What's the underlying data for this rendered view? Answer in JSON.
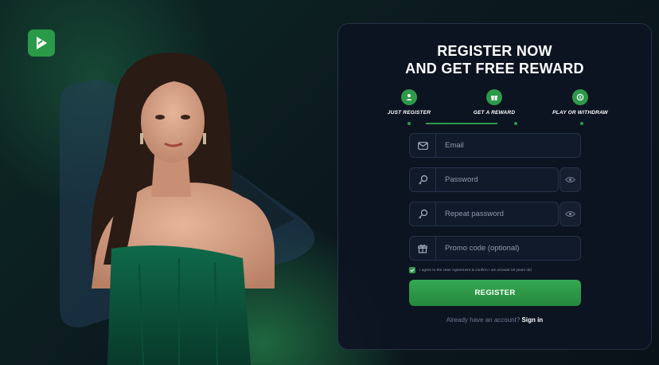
{
  "colors": {
    "accent": "#2d9a4a",
    "panel_bg": "#0d1422",
    "field_bg": "#111a2a",
    "border": "#26314a"
  },
  "brand": {
    "logo_icon": "play-logo-icon"
  },
  "hero": {
    "image": "woman in green strapless dress"
  },
  "register": {
    "title_line1": "REGISTER NOW",
    "title_line2": "AND GET FREE REWARD",
    "steps": [
      {
        "label": "JUST REGISTER",
        "icon": "user-icon"
      },
      {
        "label": "GET A REWARD",
        "icon": "gift-icon"
      },
      {
        "label": "PLAY OR WITHDRAW",
        "icon": "coin-icon"
      }
    ],
    "fields": {
      "email": {
        "placeholder": "Email",
        "value": "",
        "icon": "mail-icon"
      },
      "password": {
        "placeholder": "Password",
        "value": "",
        "icon": "key-icon"
      },
      "repeat_password": {
        "placeholder": "Repeat password",
        "value": "",
        "icon": "key-icon"
      },
      "promo": {
        "placeholder": "Promo code (optional)",
        "value": "",
        "icon": "gift-icon"
      }
    },
    "agree_text": "I agree to the User Agreement & confirm I am at least 18 years old",
    "agree_checked": true,
    "register_button": "REGISTER",
    "have_account": "Already have an account?",
    "signin_link": "Sign in"
  }
}
